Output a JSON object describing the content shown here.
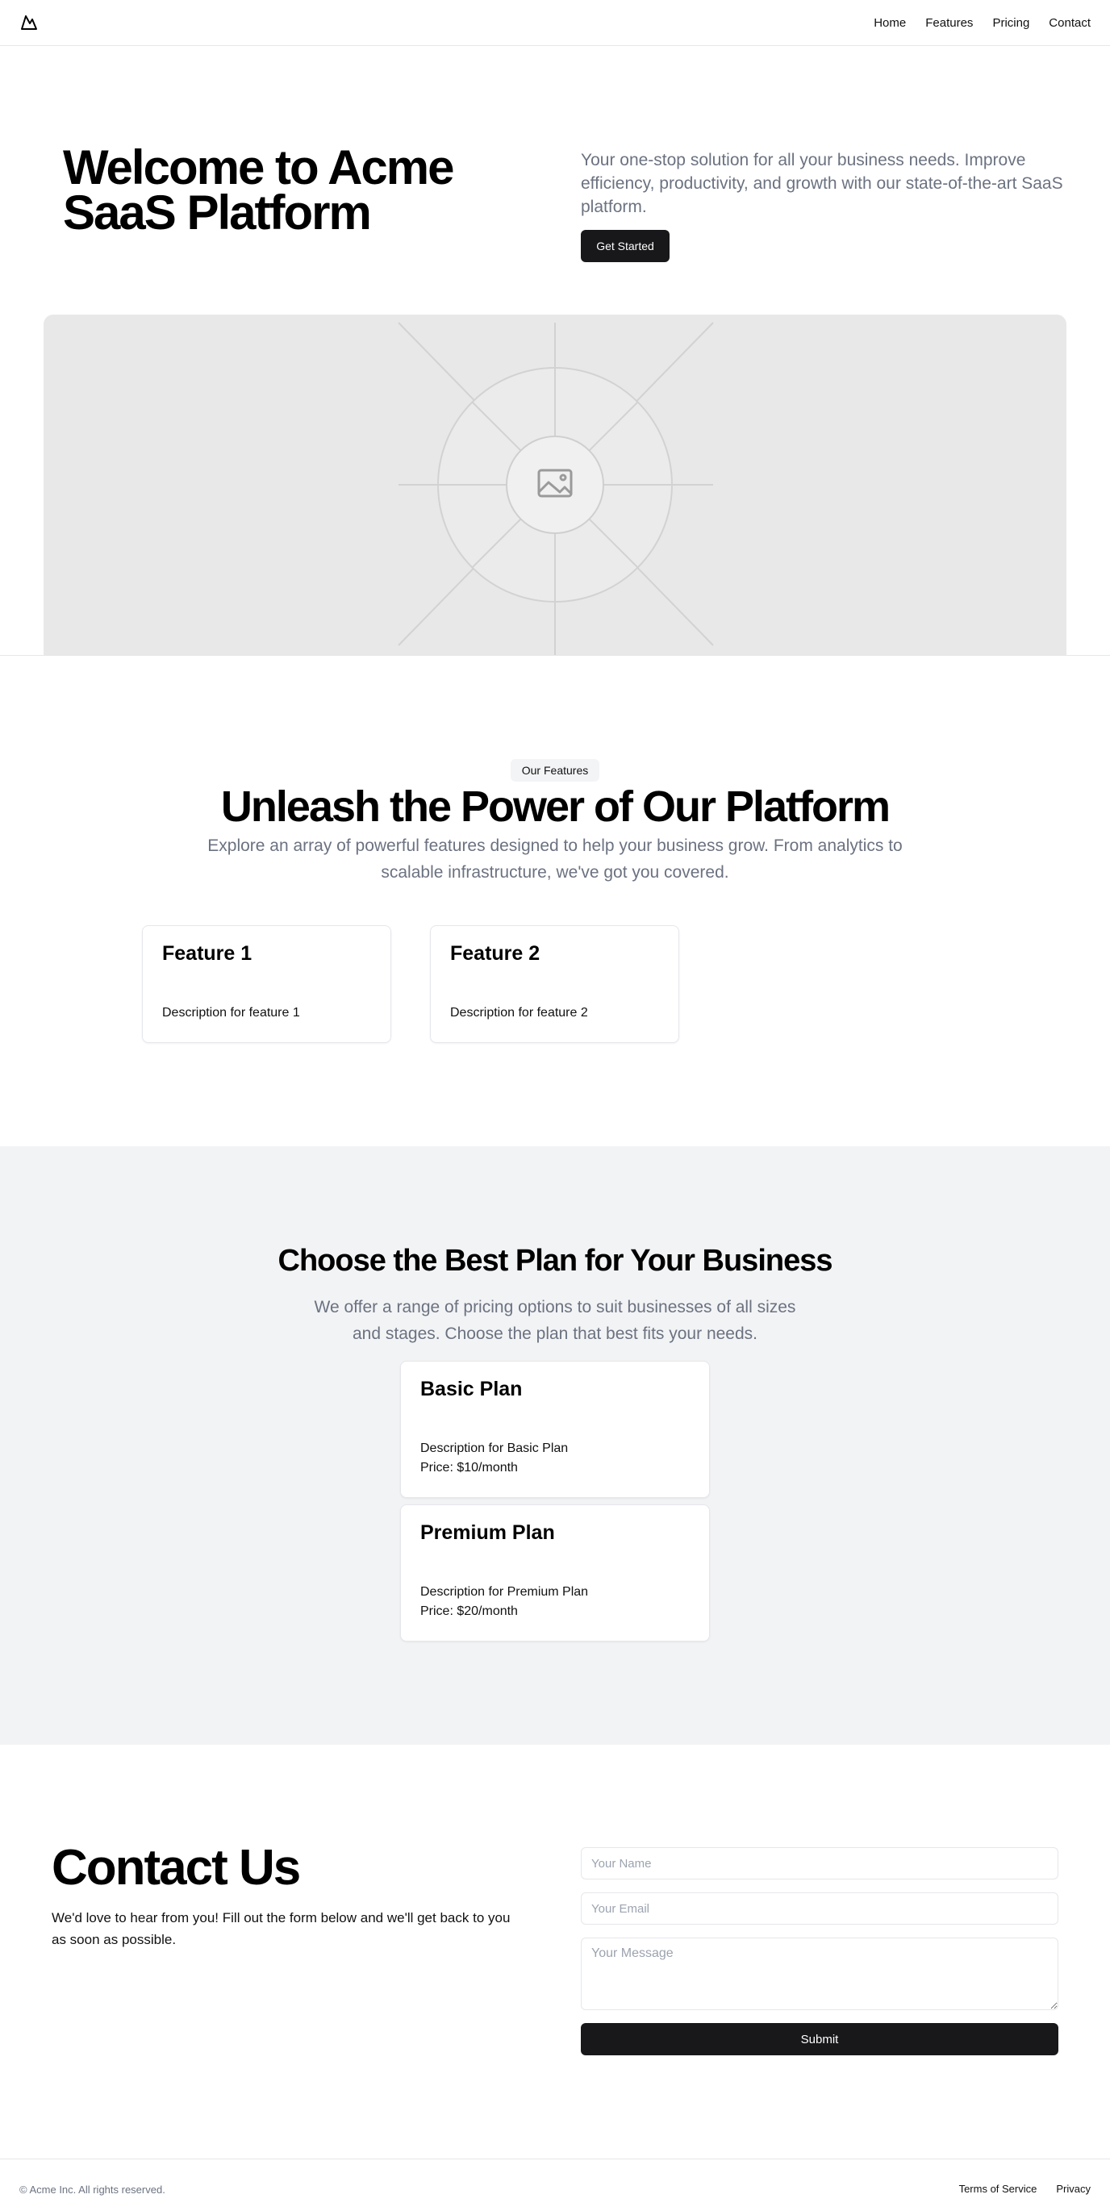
{
  "header": {
    "nav": [
      "Home",
      "Features",
      "Pricing",
      "Contact"
    ]
  },
  "hero": {
    "title": "Welcome to Acme SaaS Platform",
    "subtitle": "Your one-stop solution for all your business needs. Improve efficiency, productivity, and growth with our state-of-the-art SaaS platform.",
    "cta_label": "Get Started",
    "image_icon": "image-placeholder-icon"
  },
  "features": {
    "badge": "Our Features",
    "title": "Unleash the Power of Our Platform",
    "subtitle": "Explore an array of powerful features designed to help your business grow. From analytics to scalable infrastructure, we've got you covered.",
    "cards": [
      {
        "title": "Feature 1",
        "description": "Description for feature 1"
      },
      {
        "title": "Feature 2",
        "description": "Description for feature 2"
      }
    ]
  },
  "pricing": {
    "title": "Choose the Best Plan for Your Business",
    "subtitle": "We offer a range of pricing options to suit businesses of all sizes and stages. Choose the plan that best fits your needs.",
    "plans": [
      {
        "title": "Basic Plan",
        "description": "Description for Basic Plan",
        "price": "Price: $10/month"
      },
      {
        "title": "Premium Plan",
        "description": "Description for Premium Plan",
        "price": "Price: $20/month"
      }
    ]
  },
  "contact": {
    "title": "Contact Us",
    "subtitle": "We'd love to hear from you! Fill out the form below and we'll get back to you as soon as possible.",
    "name_placeholder": "Your Name",
    "email_placeholder": "Your Email",
    "message_placeholder": "Your Message",
    "submit_label": "Submit"
  },
  "footer": {
    "copyright": "© Acme Inc. All rights reserved.",
    "links": [
      "Terms of Service",
      "Privacy"
    ]
  },
  "colors": {
    "primary_button": "#18181b",
    "muted_text": "#6b7280",
    "pricing_bg": "#f2f3f5"
  }
}
